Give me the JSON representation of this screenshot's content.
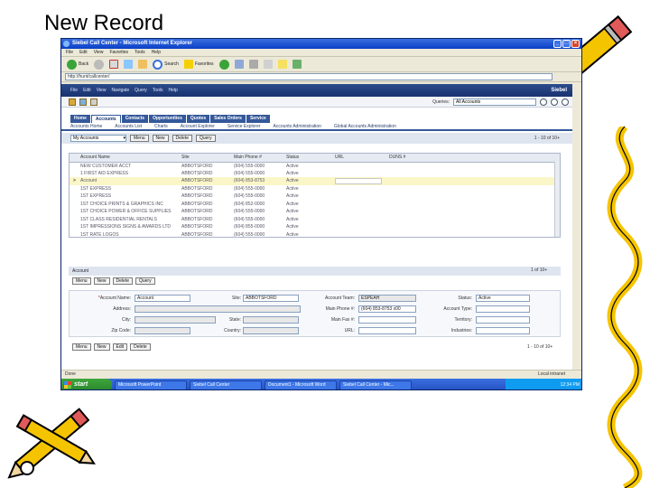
{
  "slide": {
    "title": "New Record"
  },
  "window": {
    "title": "Siebel Call Center - Microsoft Internet Explorer",
    "menu": [
      "File",
      "Edit",
      "View",
      "Favorites",
      "Tools",
      "Help"
    ],
    "toolbar": {
      "back": "Back",
      "search": "Search",
      "favorites": "Favorites"
    },
    "address": "http://hunt/callcenter/"
  },
  "app": {
    "header_links": [
      "File",
      "Edit",
      "View",
      "Navigate",
      "Query",
      "Tools",
      "Help"
    ],
    "logo": "Siebel",
    "queries_label": "Queries:",
    "queries_value": "All Accounts",
    "tabs": [
      {
        "label": "Home",
        "active": false
      },
      {
        "label": "Accounts",
        "active": true
      },
      {
        "label": "Contacts",
        "active": false
      },
      {
        "label": "Opportunities",
        "active": false
      },
      {
        "label": "Quotes",
        "active": false
      },
      {
        "label": "Sales Orders",
        "active": false
      },
      {
        "label": "Service",
        "active": false
      }
    ],
    "subtabs": [
      "Accounts Home",
      "Accounts List",
      "Charts",
      "Account Explorer",
      "Service Explorer",
      "Accounts Administration",
      "Global Accounts Administration"
    ],
    "list": {
      "view_selector": "My Accounts",
      "menu_button": "Menu",
      "new_button": "New",
      "delete_button": "Delete",
      "query_button": "Query",
      "pager": "1 - 10 of 10+",
      "columns": [
        "Account Name",
        "Site",
        "Main Phone #",
        "Status",
        "URL",
        "DUNS #"
      ],
      "rows": [
        [
          "NEW CUSTOMER ACCT",
          "ABBOTSFORD",
          "(604) 555-0000",
          "Active",
          "",
          ""
        ],
        [
          "1 FIRST AID EXPRESS",
          "ABBOTSFORD",
          "(604) 555-0000",
          "Active",
          "",
          ""
        ],
        [
          "Account",
          "ABBOTSFORD",
          "(604) 853-8753",
          "Active",
          "",
          ""
        ],
        [
          "1ST EXPRESS",
          "ABBOTSFORD",
          "(604) 555-0000",
          "Active",
          "",
          ""
        ],
        [
          "1ST EXPRESS",
          "ABBOTSFORD",
          "(604) 555-0000",
          "Active",
          "",
          ""
        ],
        [
          "1ST CHOICE PRINTS & GRAPHICS INC",
          "ABBOTSFORD",
          "(604) 852-0000",
          "Active",
          "",
          ""
        ],
        [
          "1ST CHOICE POWER & OFFICE SUPPLIES",
          "ABBOTSFORD",
          "(604) 555-0000",
          "Active",
          "",
          ""
        ],
        [
          "1ST CLASS RESIDENTIAL RENTALS",
          "ABBOTSFORD",
          "(604) 555-0000",
          "Active",
          "",
          ""
        ],
        [
          "1ST IMPRESSIONS SIGNS & AWARDS LTD",
          "ABBOTSFORD",
          "(604) 855-0000",
          "Active",
          "",
          ""
        ],
        [
          "1ST RATE LOGOS",
          "ABBOTSFORD",
          "(604) 555-0000",
          "Active",
          "",
          ""
        ]
      ],
      "selected_row": 2
    },
    "form": {
      "title": "Account",
      "menu_button": "Menu",
      "new_button": "New",
      "delete_button": "Delete",
      "query_button": "Query",
      "pager": "1 of 10+",
      "fields": {
        "account_name_label": "Account Name:",
        "account_name_value": "Account",
        "site_label": "Site:",
        "site_value": "ABBOTSFORD",
        "account_team_label": "Account Team:",
        "account_team_value": "ESPEAH",
        "status_label": "Status:",
        "status_value": "Active",
        "address_label": "Address:",
        "address_value": "",
        "main_phone_label": "Main Phone #:",
        "main_phone_value": "(604) 853-8753 x00",
        "account_type_label": "Account Type:",
        "account_type_value": "",
        "city_label": "City:",
        "city_value": "",
        "state_label": "State:",
        "state_value": "",
        "main_fax_label": "Main Fax #:",
        "main_fax_value": "",
        "territory_label": "Territory:",
        "territory_value": "",
        "zip_label": "Zip Code:",
        "zip_value": "",
        "country_label": "Country:",
        "country_value": "",
        "url_label": "URL:",
        "url_value": "",
        "industries_label": "Industries:",
        "industries_value": ""
      }
    },
    "bottom": {
      "menu_button": "Menu",
      "new_button": "New",
      "edit_button": "Edit",
      "delete_button": "Delete",
      "pager": "1 - 10 of 10+"
    }
  },
  "statusbar": {
    "text": "Done",
    "zone": "Local intranet"
  },
  "taskbar": {
    "start": "start",
    "tasks": [
      "Microsoft PowerPoint",
      "Siebel Call Center",
      "Document1 - Microsoft Word",
      "Siebel Call Center - Mic..."
    ],
    "tray_time": "12:34 PM"
  }
}
